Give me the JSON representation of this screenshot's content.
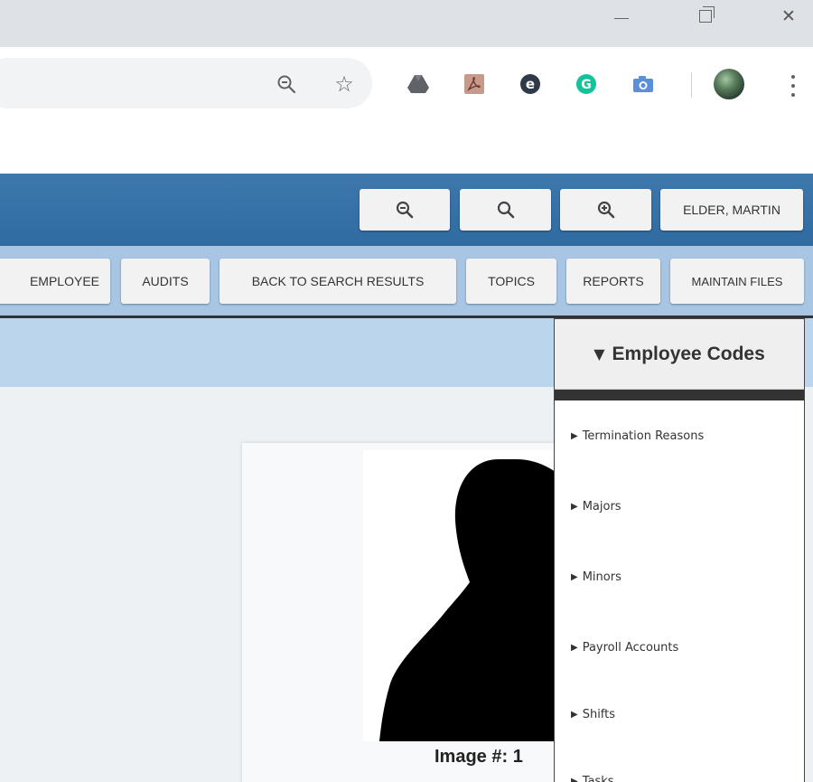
{
  "browser": {
    "window_controls": {
      "minimize": "—",
      "maximize": "",
      "close": "✕"
    },
    "toolbar_icons": [
      "zoom-out-icon",
      "star-icon",
      "google-drive-icon",
      "adobe-pdf-icon",
      "e-extension-icon",
      "grammarly-icon",
      "camera-icon",
      "profile-avatar",
      "menu-icon"
    ]
  },
  "header": {
    "user_name": "ELDER, MARTIN"
  },
  "nav": {
    "employee": "EMPLOYEE",
    "audits": "AUDITS",
    "back_to_search": "BACK TO SEARCH RESULTS",
    "topics": "TOPICS",
    "reports": "REPORTS",
    "maintain_files": "MAINTAIN FILES"
  },
  "employee_codes": {
    "arrow": "▼",
    "title": "Employee Codes",
    "items": [
      {
        "label": "Termination Reasons"
      },
      {
        "label": "Majors"
      },
      {
        "label": "Minors"
      },
      {
        "label": "Payroll Accounts"
      },
      {
        "label": "Shifts"
      },
      {
        "label": "Tasks"
      }
    ]
  },
  "image": {
    "label": "Image #: 1"
  },
  "colors": {
    "header_blue": "#3470a6",
    "nav_blue": "#a8c6e4",
    "subbar_blue": "#bad5ec"
  }
}
